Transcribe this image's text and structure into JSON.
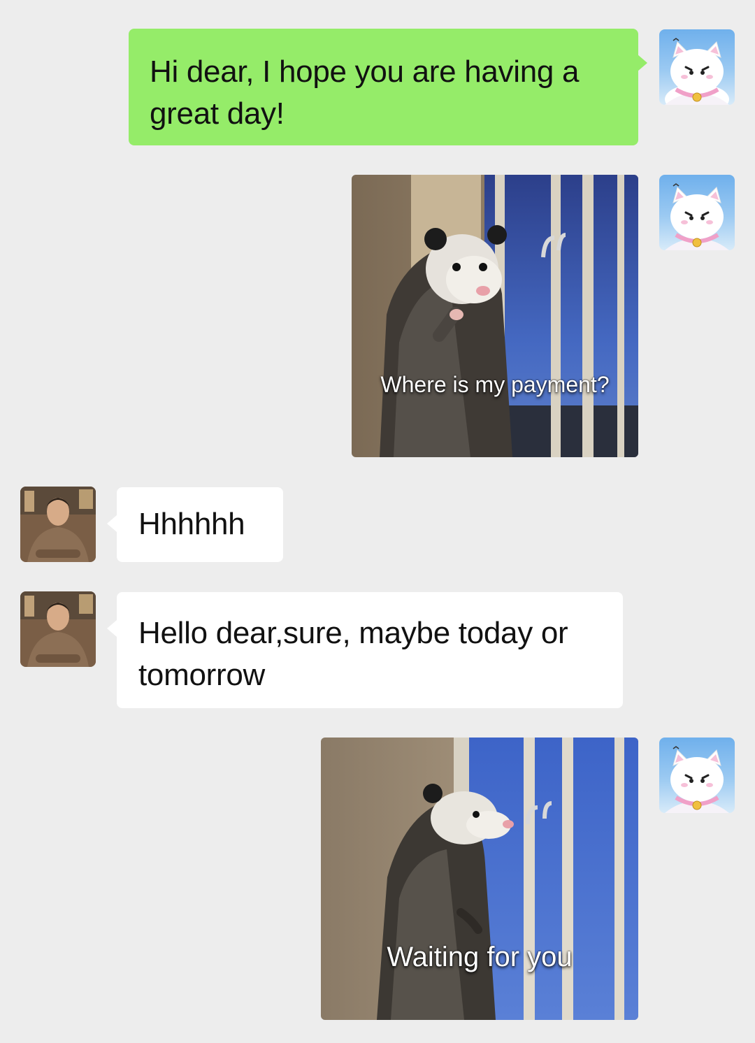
{
  "messages": [
    {
      "sender": "me",
      "type": "text",
      "text": "Hi dear, I hope you are having a great day!"
    },
    {
      "sender": "me",
      "type": "image",
      "caption": "Where is my payment?"
    },
    {
      "sender": "other",
      "type": "text",
      "text": "Hhhhhh"
    },
    {
      "sender": "other",
      "type": "text",
      "text": "Hello dear,sure, maybe today or tomorrow"
    },
    {
      "sender": "me",
      "type": "image",
      "caption": "Waiting for you"
    }
  ],
  "colors": {
    "background": "#ededed",
    "sent_bubble": "#95ec69",
    "received_bubble": "#ffffff"
  }
}
